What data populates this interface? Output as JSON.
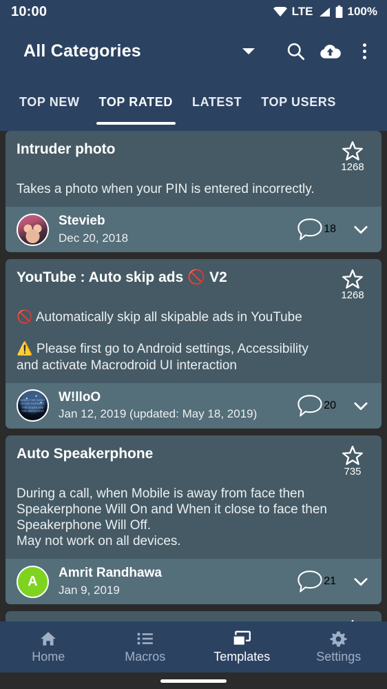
{
  "colors": {
    "appbar": "#2c4261",
    "card": "#455a64",
    "card_footer": "#546e7a",
    "page_background": "#2b2b2b",
    "accent_white": "#ffffff",
    "avatar_green": "#7ed321",
    "inactive_nav": "#9fb0c6"
  },
  "statusbar": {
    "clock": "10:00",
    "wifi_icon": "wifi-icon",
    "network": "LTE",
    "signal_icon": "signal-icon",
    "battery_icon": "battery-icon",
    "battery": "100%"
  },
  "appbar": {
    "title": "All Categories",
    "dropdown_icon": "chevron-down-icon",
    "search_icon": "search-icon",
    "upload_icon": "cloud-upload-icon",
    "overflow_icon": "more-vertical-icon"
  },
  "tabs": [
    {
      "label": "TOP NEW",
      "active": false
    },
    {
      "label": "TOP RATED",
      "active": true
    },
    {
      "label": "LATEST",
      "active": false
    },
    {
      "label": "TOP USERS",
      "active": false
    }
  ],
  "cards": [
    {
      "title": "Intruder photo",
      "description": "Takes a photo when your PIN is entered incorrectly.",
      "star_icon": "star-outline-icon",
      "rating": "1268",
      "author": "Stevieb",
      "date": "Dec 20, 2018",
      "avatar_type": "photo",
      "avatar_letter": "",
      "comments": "18",
      "comment_icon": "comment-bubble-icon",
      "expand_icon": "chevron-down-icon"
    },
    {
      "title": "YouTube : Auto skip ads 🚫 V2",
      "description": "🚫 Automatically skip all skipable ads in YouTube\n\n⚠️ Please first go to Android settings, Accessibility and activate Macrodroid UI interaction",
      "star_icon": "star-outline-icon",
      "rating": "1268",
      "author": "W!lloO",
      "date": "Jan 12, 2019 (updated: May 18, 2019)",
      "avatar_type": "night",
      "avatar_text": "WHEN THE NIGHT IS THE DARKEST THE STARS ARE THE BRIGHTEST",
      "avatar_letter": "",
      "comments": "20",
      "comment_icon": "comment-bubble-icon",
      "expand_icon": "chevron-down-icon"
    },
    {
      "title": "Auto Speakerphone",
      "description": "During a call, when Mobile is away from face then Speakerphone Will On and When it close to face then Speakerphone Will Off.\nMay not work on all devices.",
      "star_icon": "star-outline-icon",
      "rating": "735",
      "author": "Amrit Randhawa",
      "date": "Jan 9, 2019",
      "avatar_type": "letter",
      "avatar_letter": "A",
      "comments": "21",
      "comment_icon": "comment-bubble-icon",
      "expand_icon": "chevron-down-icon"
    }
  ],
  "bottom_nav": [
    {
      "label": "Home",
      "icon": "home-icon",
      "active": false
    },
    {
      "label": "Macros",
      "icon": "list-icon",
      "active": false
    },
    {
      "label": "Templates",
      "icon": "templates-icon",
      "active": true
    },
    {
      "label": "Settings",
      "icon": "gear-icon",
      "active": false
    }
  ]
}
